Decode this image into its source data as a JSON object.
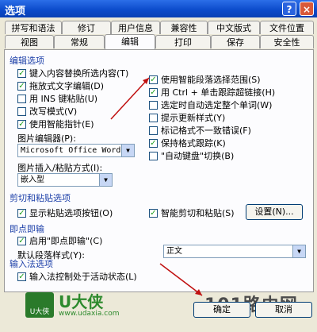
{
  "window": {
    "title": "选项",
    "help": "?",
    "close": "×"
  },
  "tabs_row1": [
    "拼写和语法",
    "修订",
    "用户信息",
    "兼容性",
    "中文版式",
    "文件位置"
  ],
  "tabs_row2": [
    "视图",
    "常规",
    "编辑",
    "打印",
    "保存",
    "安全性"
  ],
  "edit_options": {
    "group": "编辑选项",
    "left": [
      {
        "label": "键入内容替换所选内容(T)",
        "checked": true
      },
      {
        "label": "拖放式文字编辑(D)",
        "checked": true
      },
      {
        "label": "用 INS 键粘贴(U)",
        "checked": false
      },
      {
        "label": "改写模式(V)",
        "checked": false
      },
      {
        "label": "使用智能指针(E)",
        "checked": true
      }
    ],
    "right": [
      {
        "label": "使用智能段落选择范围(S)",
        "checked": true
      },
      {
        "label": "用 Ctrl + 单击跟踪超链接(H)",
        "checked": true
      },
      {
        "label": "选定时自动选定整个单词(W)",
        "checked": false
      },
      {
        "label": "提示更新样式(Y)",
        "checked": false
      },
      {
        "label": "标记格式不一致错误(F)",
        "checked": false
      },
      {
        "label": "保持格式跟踪(K)",
        "checked": true
      },
      {
        "label": "\"自动键盘\"切换(B)",
        "checked": false
      }
    ],
    "picture_editor_label": "图片编辑器(P):",
    "picture_editor_value": "Microsoft Office Word",
    "picture_insert_label": "图片插入/粘贴方式(I):",
    "picture_insert_value": "嵌入型"
  },
  "cut_paste": {
    "group": "剪切和粘贴选项",
    "show_paste_buttons": {
      "label": "显示粘贴选项按钮(O)",
      "checked": true
    },
    "smart_cut": {
      "label": "智能剪切和粘贴(S)",
      "checked": true
    },
    "settings_button": "设置(N)..."
  },
  "click_type": {
    "group": "即点即输",
    "enable": {
      "label": "启用\"即点即输\"(C)",
      "checked": true
    },
    "default_style_label": "默认段落样式(Y):",
    "default_style_value": "正文"
  },
  "ime": {
    "group": "输入法选项",
    "ime_control": {
      "label": "输入法控制处于活动状态(L)",
      "checked": true
    }
  },
  "buttons": {
    "ok": "确定",
    "cancel": "取消"
  },
  "watermark": {
    "brand": "U大侠",
    "site": "www.udaxia.com",
    "badge": "U大侠",
    "site2": "101路由网"
  }
}
